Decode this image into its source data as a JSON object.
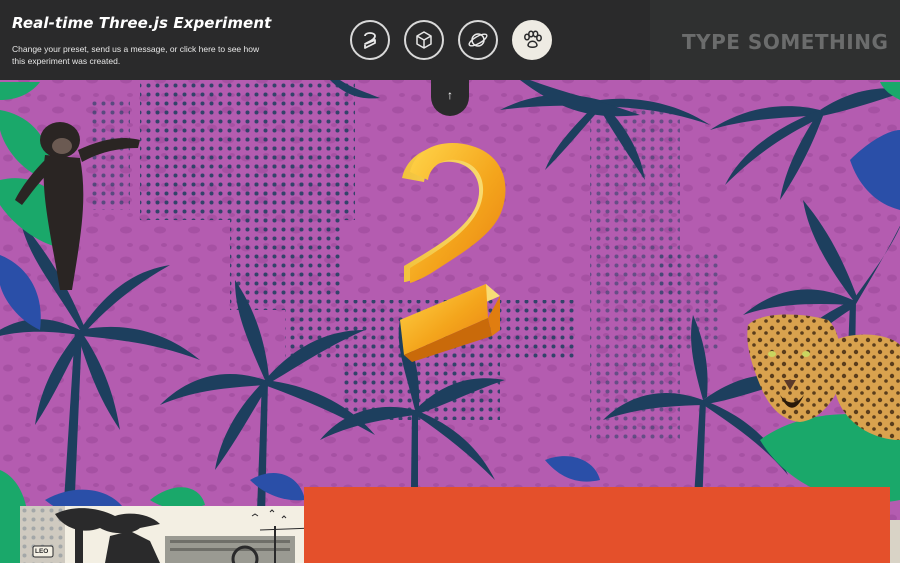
{
  "header": {
    "title": "Real-time Three.js Experiment",
    "subtitle": "Change your preset, send us a message, or click here to see how this experiment was created."
  },
  "presets": [
    {
      "icon": "number-two-icon",
      "active": false
    },
    {
      "icon": "cube-icon",
      "active": false
    },
    {
      "icon": "planet-icon",
      "active": false
    },
    {
      "icon": "paw-icon",
      "active": true
    }
  ],
  "message_input": {
    "placeholder": "TYPE SOMETHING..."
  },
  "collapse_arrow": "↑",
  "bottom_card_left": {
    "badge": "LEO"
  },
  "colors": {
    "bar": "#2a2a2b",
    "background": "#b45cb0",
    "palm": "#1d3f5e",
    "leaf": "#1aa86a",
    "shape": "#f0b21b",
    "card": "#e4502b"
  }
}
